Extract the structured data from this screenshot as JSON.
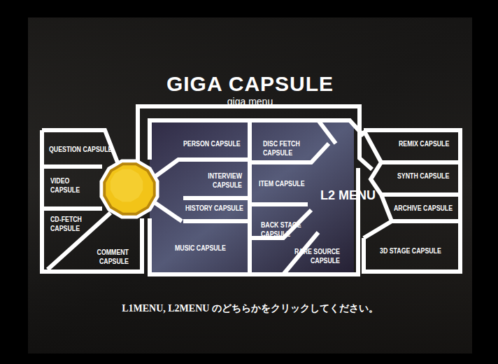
{
  "header": {
    "title": "GIGA CAPSULE",
    "subtitle": "giga menu"
  },
  "left_menu": {
    "items": [
      {
        "label": "QUESTION CAPSULE"
      },
      {
        "label": "VIDEO CAPSULE"
      },
      {
        "label": "CD-FETCH CAPSULE"
      },
      {
        "label": "COMMENT CAPSULE"
      }
    ]
  },
  "center_menu": {
    "label": "L2 MENU",
    "items": [
      {
        "label": "PERSON CAPSULE"
      },
      {
        "label": "INTERVIEW CAPSULE"
      },
      {
        "label": "HISTORY CAPSULE"
      },
      {
        "label": "MUSIC CAPSULE"
      },
      {
        "label": "DISC FETCH CAPSULE"
      },
      {
        "label": "ITEM CAPSULE"
      },
      {
        "label": "BACK STAGE CAPSULE"
      },
      {
        "label": "RARE SOURCE CAPSULE"
      }
    ]
  },
  "right_menu": {
    "items": [
      {
        "label": "REMIX CAPSULE"
      },
      {
        "label": "SYNTH CAPSULE"
      },
      {
        "label": "ARCHIVE CAPSULE"
      },
      {
        "label": "3D STAGE CAPSULE"
      }
    ]
  },
  "instruction": "L1MENU, L2MENU のどちらかをクリックしてください。"
}
